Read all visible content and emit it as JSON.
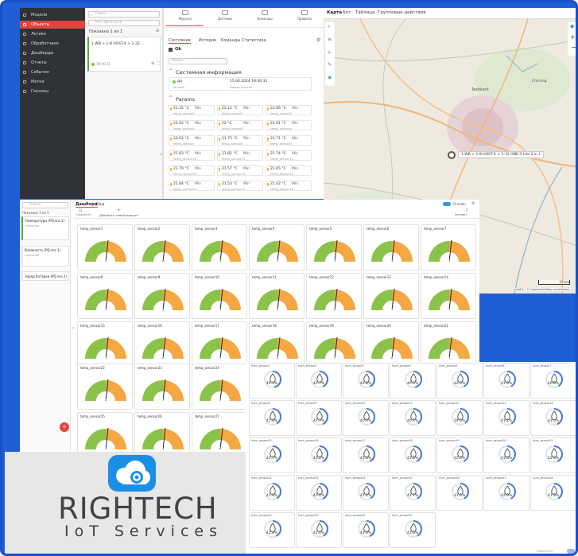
{
  "sidebar": {
    "items": [
      {
        "label": "Модели"
      },
      {
        "label": "Объекты"
      },
      {
        "label": "Логика"
      },
      {
        "label": "Обработчики"
      },
      {
        "label": "Дашборды"
      },
      {
        "label": "Отчеты"
      },
      {
        "label": "События"
      },
      {
        "label": "Метки"
      },
      {
        "label": "Геозоны"
      }
    ]
  },
  "objects": {
    "search_placeholder": "Поиск ...",
    "filter_label": "Нет фильтров",
    "shown": "Показано 1 из 1",
    "card_title": "1 WB > 1-8 HOST-X > 1-32 ...",
    "card_time": "19:40:31"
  },
  "detail": {
    "tabs": [
      {
        "label": "Журнал"
      },
      {
        "label": "Датчики"
      },
      {
        "label": "Команды"
      },
      {
        "label": "Правила"
      }
    ],
    "subtabs": [
      {
        "label": "Состояние"
      },
      {
        "label": "История"
      },
      {
        "label": "Команды"
      },
      {
        "label": "Статистика"
      }
    ],
    "ok_label": "Ok",
    "search_placeholder": "Поиск ...",
    "sysinfo_title": "Системная информация",
    "online_value": "да",
    "online_label": "Онлайн",
    "time_value": "15.04.2024 19:40:31",
    "time_label": "Время пакета",
    "params_title": "Params",
    "params": [
      {
        "v": "21.32 °C",
        "u": "Min",
        "n": "temp_sensor1"
      },
      {
        "v": "22.12 °C",
        "u": "Min",
        "n": "temp_sensor2"
      },
      {
        "v": "22.06 °C",
        "u": "Min",
        "n": "temp_sensor3"
      },
      {
        "v": "22.02 °C",
        "u": "Min",
        "n": "temp_sensor4"
      },
      {
        "v": "22 °C",
        "u": "Min",
        "n": "temp_sensor5"
      },
      {
        "v": "21.91 °C",
        "u": "Min",
        "n": "temp_sensor6"
      },
      {
        "v": "22.02 °C",
        "u": "Min",
        "n": "temp_sensor7"
      },
      {
        "v": "21.75 °C",
        "u": "Min",
        "n": "temp_sensor8"
      },
      {
        "v": "21.71 °C",
        "u": "Min",
        "n": "temp_sensor9"
      },
      {
        "v": "21.83 °C",
        "u": "Min",
        "n": "temp_sensor10"
      },
      {
        "v": "21.82 °C",
        "u": "Min",
        "n": "temp_sensor11"
      },
      {
        "v": "21.74 °C",
        "u": "Min",
        "n": "temp_sensor12"
      },
      {
        "v": "21.79 °C",
        "u": "Min",
        "n": "temp_sensor13"
      },
      {
        "v": "21.57 °C",
        "u": "Min",
        "n": "temp_sensor14"
      },
      {
        "v": "21.65 °C",
        "u": "Min",
        "n": "temp_sensor15"
      },
      {
        "v": "21.84 °C",
        "u": "Min",
        "n": "temp_sensor16"
      },
      {
        "v": "21.53 °C",
        "u": "Min",
        "n": "temp_sensor17"
      },
      {
        "v": "21.42 °C",
        "u": "Min",
        "n": "temp_sensor18"
      }
    ]
  },
  "map": {
    "tabs": [
      {
        "label": "Карта"
      },
      {
        "label": "Бот"
      },
      {
        "label": "Таблица"
      },
      {
        "label": "Групповые действия"
      }
    ],
    "marker_label": "1 WB > 1-8 HOST-X > 1-32 ONE-X Lite 2 in 1",
    "city": "Tashkent",
    "city2": "Chirchiq",
    "scale": "10 km",
    "attribution": "Leaflet | © OpenStreetMap contributors"
  },
  "dashboard": {
    "search_placeholder": "Поиск",
    "shown": "Показано 3 из 3",
    "tabs": [
      {
        "label": "Дашборд"
      },
      {
        "label": "Код"
      }
    ],
    "back_label": "Сохранить",
    "add_widget_label": "Добавить новый виджет",
    "live_label": "Онлайн",
    "export_label": "Экспорт",
    "list": [
      {
        "title": "Температуры (PQ.sns.1)",
        "sub": "Описание"
      },
      {
        "title": "Влажность (PQ.sns.1)",
        "sub": "Описание"
      },
      {
        "title": "Заряд батареи (PQ.sns.1)",
        "sub": ""
      }
    ],
    "gauges": [
      {
        "name": "temp_sensor1",
        "value": "20.01 °C"
      },
      {
        "name": "temp_sensor2",
        "value": "20.83 °C"
      },
      {
        "name": "temp_sensor3",
        "value": "20.86 °C"
      },
      {
        "name": "temp_sensor4",
        "value": "20.84 °C"
      },
      {
        "name": "temp_sensor5",
        "value": "20.78 °C"
      },
      {
        "name": "temp_sensor6",
        "value": "20.80 °C"
      },
      {
        "name": "temp_sensor7",
        "value": "20.76 °C"
      },
      {
        "name": "temp_sensor8",
        "value": "20.69 °C"
      },
      {
        "name": "temp_sensor9",
        "value": "20.65 °C"
      },
      {
        "name": "temp_sensor10",
        "value": "20.70 °C"
      },
      {
        "name": "temp_sensor11",
        "value": "20.72 °C"
      },
      {
        "name": "temp_sensor12",
        "value": "20.63 °C"
      },
      {
        "name": "temp_sensor13",
        "value": "20.56 °C"
      },
      {
        "name": "temp_sensor14",
        "value": "20.14 °C"
      },
      {
        "name": "temp_sensor15",
        "value": "20.06 °C"
      },
      {
        "name": "temp_sensor16",
        "value": "20.01 °C"
      },
      {
        "name": "temp_sensor17",
        "value": "20.54 °C"
      },
      {
        "name": "temp_sensor18",
        "value": "20.21 °C"
      },
      {
        "name": "temp_sensor19",
        "value": "20.14 °C"
      },
      {
        "name": "temp_sensor20",
        "value": "20.41 °C"
      },
      {
        "name": "temp_sensor21",
        "value": "20.66 °C"
      },
      {
        "name": "temp_sensor22",
        "value": "20.61 °C"
      },
      {
        "name": "temp_sensor23",
        "value": "20.18 °C"
      },
      {
        "name": "temp_sensor24",
        "value": "20.19 °C"
      },
      {
        "name": "temp_sensor25",
        "value": "20.89 °C"
      },
      {
        "name": "temp_sensor26",
        "value": "20.8 °C"
      },
      {
        "name": "temp_sensor27",
        "value": "20.73 °C"
      }
    ]
  },
  "humidity": {
    "tiles": [
      {
        "name": "hum_sensor1",
        "value": "46.3%"
      },
      {
        "name": "hum_sensor2",
        "value": "42.7%"
      },
      {
        "name": "hum_sensor3",
        "value": "42.6%"
      },
      {
        "name": "hum_sensor4",
        "value": "46.3%"
      },
      {
        "name": "hum_sensor5",
        "value": "42.5%"
      },
      {
        "name": "hum_sensor6",
        "value": "41.5%"
      },
      {
        "name": "hum_sensor7",
        "value": "40.8%"
      },
      {
        "name": "hum_sensor8",
        "value": "41.0%"
      },
      {
        "name": "hum_sensor9",
        "value": "43.3%"
      },
      {
        "name": "hum_sensor10",
        "value": "40.5%"
      },
      {
        "name": "hum_sensor11",
        "value": "40.1%"
      },
      {
        "name": "hum_sensor12",
        "value": "39.5%"
      },
      {
        "name": "hum_sensor13",
        "value": "41.1%"
      },
      {
        "name": "hum_sensor14",
        "value": "43.5%"
      },
      {
        "name": "hum_sensor15",
        "value": "42.7%"
      },
      {
        "name": "hum_sensor16",
        "value": "43.2%"
      },
      {
        "name": "hum_sensor17",
        "value": "42.6%"
      },
      {
        "name": "hum_sensor18",
        "value": "43.0%"
      },
      {
        "name": "hum_sensor19",
        "value": "42.3%"
      },
      {
        "name": "hum_sensor20",
        "value": "41.8%"
      },
      {
        "name": "hum_sensor21",
        "value": "42.6%"
      },
      {
        "name": "hum_sensor22",
        "value": "41.0%"
      },
      {
        "name": "hum_sensor23",
        "value": "43.1%"
      },
      {
        "name": "hum_sensor24",
        "value": "41.1%"
      },
      {
        "name": "hum_sensor25",
        "value": "41.7%"
      },
      {
        "name": "hum_sensor26",
        "value": "41.5%"
      },
      {
        "name": "hum_sensor27",
        "value": "42.0%"
      },
      {
        "name": "hum_sensor28",
        "value": "41.5%"
      },
      {
        "name": "hum_sensor29",
        "value": "42.4%"
      },
      {
        "name": "hum_sensor30",
        "value": "42.1%"
      },
      {
        "name": "hum_sensor31",
        "value": "43.0%"
      },
      {
        "name": "hum_sensor32",
        "value": "41.6%"
      }
    ],
    "footer": "Powered by"
  },
  "brand": {
    "name": "RIGHTECH",
    "tagline": "IoT Services"
  },
  "colors": {
    "accent": "#e0443c",
    "frame": "#1f5fd6",
    "green": "#8bc34a",
    "orange": "#f4a742",
    "ring": "#4a78d6"
  }
}
